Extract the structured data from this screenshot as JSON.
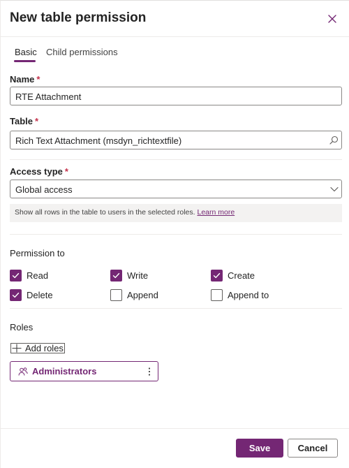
{
  "header": {
    "title": "New table permission",
    "close_icon": "close-icon"
  },
  "tabs": [
    {
      "label": "Basic",
      "active": true
    },
    {
      "label": "Child permissions",
      "active": false
    }
  ],
  "name_field": {
    "label": "Name",
    "required_mark": "*",
    "value": "RTE Attachment"
  },
  "table_field": {
    "label": "Table",
    "required_mark": "*",
    "value": "Rich Text Attachment (msdyn_richtextfile)",
    "icon": "search-icon"
  },
  "access_type": {
    "label": "Access type",
    "required_mark": "*",
    "value": "Global access",
    "icon": "chevron-down-icon",
    "info_text": "Show all rows in the table to users in the selected roles.",
    "info_link": "Learn more"
  },
  "permissions": {
    "label": "Permission to",
    "items": [
      {
        "label": "Read",
        "checked": true
      },
      {
        "label": "Write",
        "checked": true
      },
      {
        "label": "Create",
        "checked": true
      },
      {
        "label": "Delete",
        "checked": true
      },
      {
        "label": "Append",
        "checked": false
      },
      {
        "label": "Append to",
        "checked": false
      }
    ]
  },
  "roles": {
    "label": "Roles",
    "add_label": "Add roles",
    "items": [
      {
        "label": "Administrators",
        "icon": "people-icon",
        "menu_icon": "more-vertical-icon"
      }
    ]
  },
  "footer": {
    "save_label": "Save",
    "cancel_label": "Cancel"
  },
  "colors": {
    "accent": "#742774",
    "required": "#c4314b",
    "info_bg": "#f3f2f1"
  }
}
